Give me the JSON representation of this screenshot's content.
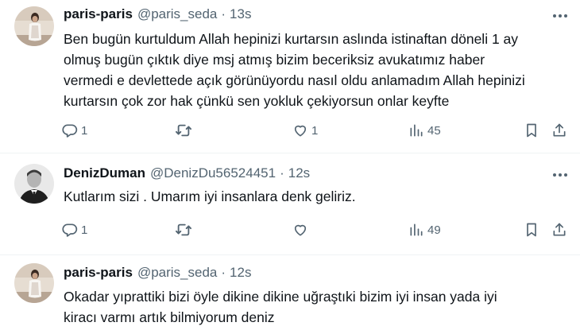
{
  "tweets": [
    {
      "name": "paris-paris",
      "handle": "@paris_seda",
      "separator": "·",
      "time": "13s",
      "lines": [
        "Ben bugün kurtuldum Allah hepinizi kurtarsın aslında istinaftan döneli 1 ay",
        "olmuş bugün çıktık diye msj atmış bizim beceriksiz avukatımız haber",
        "vermedi e devlettede açık görünüyordu nasıl oldu anlamadım Allah hepinizi",
        "kurtarsın çok zor hak çünkü sen yokluk çekiyorsun onlar keyfte"
      ],
      "actions": {
        "replies": "1",
        "retweets": "",
        "likes": "1",
        "views": "45"
      }
    },
    {
      "name": "DenizDuman",
      "handle": "@DenizDu56524451",
      "separator": "·",
      "time": "12s",
      "lines": [
        "Kutlarım sizi . Umarım iyi insanlara denk geliriz."
      ],
      "actions": {
        "replies": "1",
        "retweets": "",
        "likes": "",
        "views": "49"
      }
    },
    {
      "name": "paris-paris",
      "handle": "@paris_seda",
      "separator": "·",
      "time": "12s",
      "lines": [
        "Okadar yıprattiki bizi öyle dikine dikine uğraştıki bizim iyi insan yada iyi",
        "kiracı varmı artık bilmiyorum deniz"
      ]
    }
  ],
  "icons": {
    "reply": "comment-bubble-icon",
    "retweet": "retweet-arrows-icon",
    "like": "heart-icon",
    "views": "bar-chart-icon",
    "bookmark": "bookmark-icon",
    "share": "share-upload-icon",
    "more": "more-dots-icon"
  },
  "colors": {
    "text": "#0f1419",
    "muted": "#536471",
    "divider": "#eff3f4"
  }
}
